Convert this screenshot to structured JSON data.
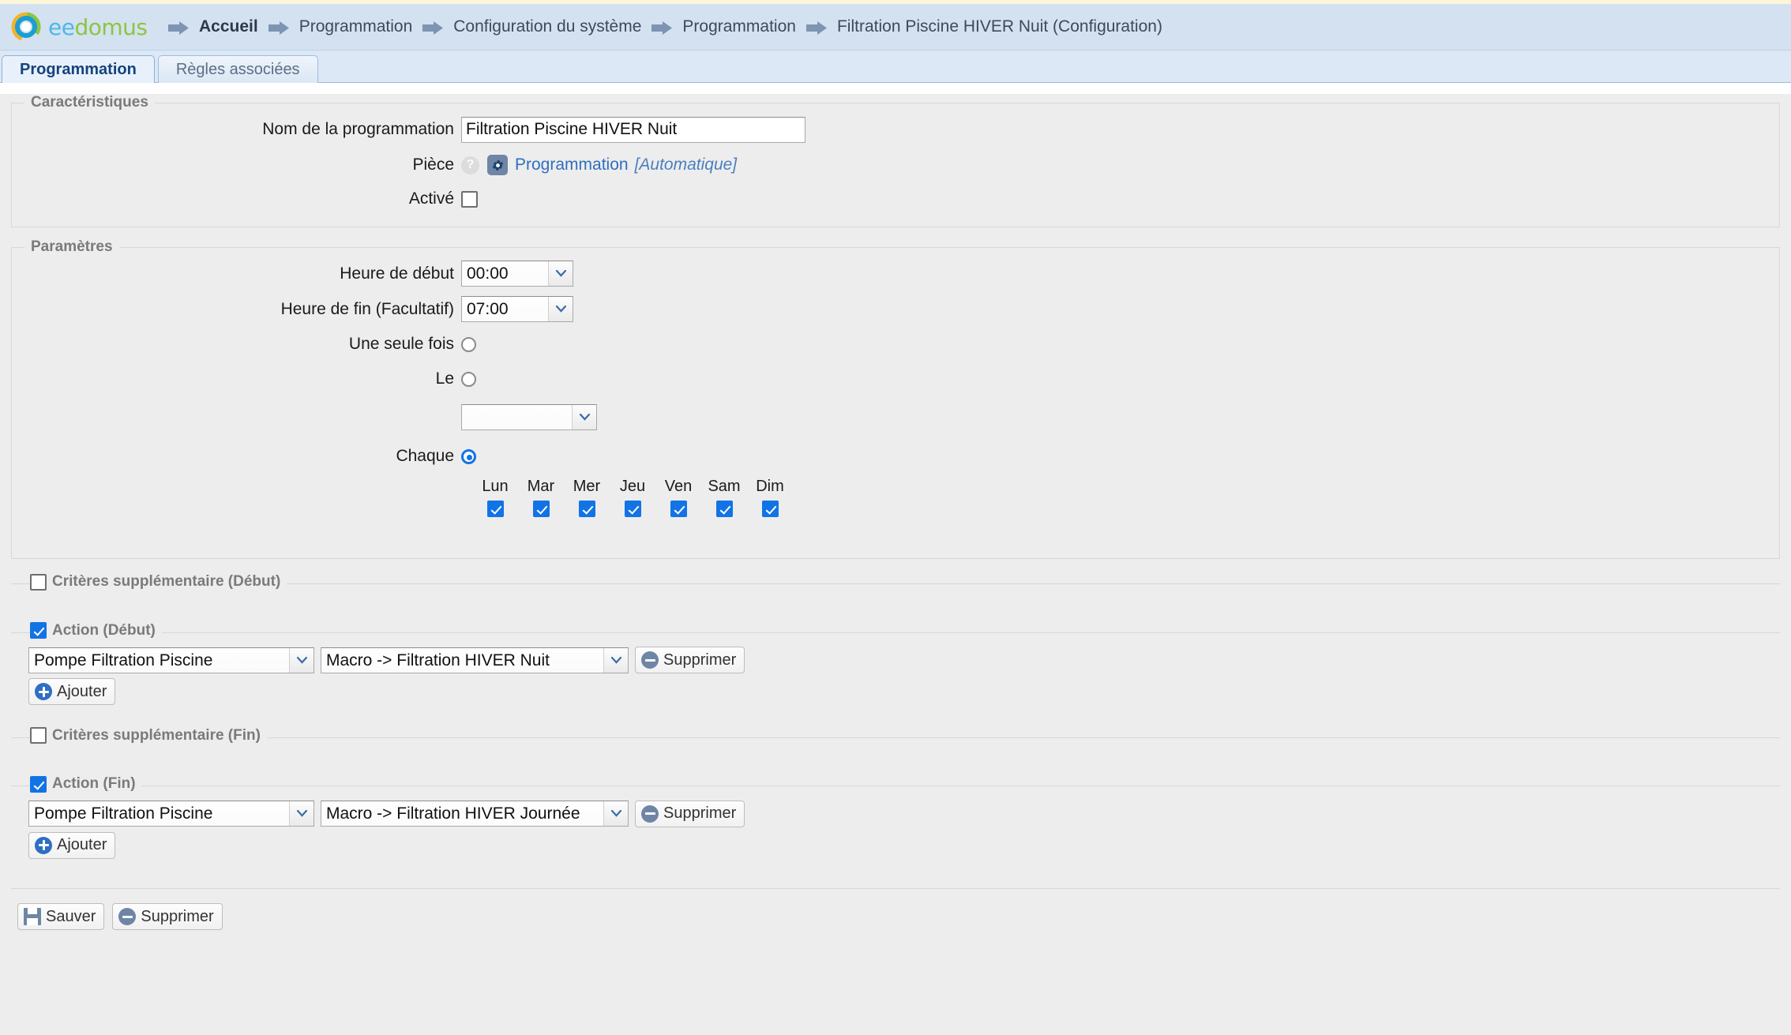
{
  "brand": {
    "name_part1": "ee",
    "name_part2": "domus",
    "logo_icon": "eedomus-ring-logo"
  },
  "breadcrumb": [
    {
      "label": "Accueil"
    },
    {
      "label": "Programmation"
    },
    {
      "label": "Configuration du système"
    },
    {
      "label": "Programmation"
    },
    {
      "label": "Filtration Piscine HIVER Nuit (Configuration)"
    }
  ],
  "tabs": [
    {
      "label": "Programmation",
      "active": true
    },
    {
      "label": "Règles associées",
      "active": false
    }
  ],
  "sections": {
    "caracteristiques": {
      "title": "Caractéristiques",
      "name_label": "Nom de la programmation",
      "name_value": "Filtration Piscine HIVER Nuit",
      "piece_label": "Pièce",
      "piece_help_glyph": "?",
      "piece_link": "Programmation",
      "piece_auto": "[Automatique]",
      "active_label": "Activé",
      "active_checked": false
    },
    "parametres": {
      "title": "Paramètres",
      "start_label": "Heure de début",
      "start_value": "00:00",
      "end_label": "Heure de fin (Facultatif)",
      "end_value": "07:00",
      "once_label": "Une seule fois",
      "once_selected": false,
      "on_label": "Le",
      "on_selected": false,
      "on_date_value": "",
      "each_label": "Chaque",
      "each_selected": true,
      "days": [
        {
          "label": "Lun",
          "checked": true
        },
        {
          "label": "Mar",
          "checked": true
        },
        {
          "label": "Mer",
          "checked": true
        },
        {
          "label": "Jeu",
          "checked": true
        },
        {
          "label": "Ven",
          "checked": true
        },
        {
          "label": "Sam",
          "checked": true
        },
        {
          "label": "Dim",
          "checked": true
        }
      ]
    },
    "criteres_debut": {
      "title": "Critères supplémentaire (Début)",
      "checked": false
    },
    "action_debut": {
      "title": "Action (Début)",
      "checked": true,
      "device": "Pompe Filtration Piscine",
      "command": "Macro -> Filtration HIVER Nuit",
      "remove_label": "Supprimer",
      "add_label": "Ajouter"
    },
    "criteres_fin": {
      "title": "Critères supplémentaire (Fin)",
      "checked": false
    },
    "action_fin": {
      "title": "Action (Fin)",
      "checked": true,
      "device": "Pompe Filtration Piscine",
      "command": "Macro -> Filtration HIVER Journée",
      "remove_label": "Supprimer",
      "add_label": "Ajouter"
    }
  },
  "footer": {
    "save_label": "Sauver",
    "delete_label": "Supprimer"
  },
  "colors": {
    "accent_blue": "#1273e6",
    "link_blue": "#2f6fbf",
    "header_bg": "#d4e1f0",
    "page_bg": "#ededed"
  }
}
